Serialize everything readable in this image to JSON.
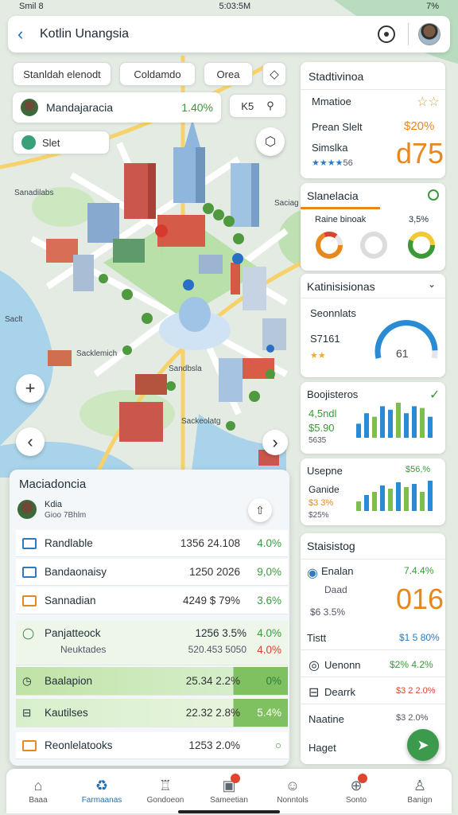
{
  "status_bar": {
    "left": "Smil 8",
    "center": "5:03:5M",
    "right": "7%"
  },
  "header": {
    "title": "Kotlin Unangsia"
  },
  "filters": {
    "chip1": "Stanldah elenodt",
    "chip2": "Coldamdo",
    "chip3": "Orea"
  },
  "user_row": {
    "name": "Mandajaracia",
    "pct": "1.40%",
    "chip": "K5"
  },
  "search_chip": {
    "label": "Slet"
  },
  "map_labels": [
    "Sanadilabs",
    "Saciag",
    "Sacklemich",
    "Sandbsla",
    "Sackeolatg",
    "Saclt"
  ],
  "stat_card": {
    "title": "Stadtivinoa",
    "row1_label": "Mmatioe",
    "row2_label": "Prean Slelt",
    "row2_value": "$20%",
    "row3_label": "Simslka",
    "big_value": "d75",
    "rating_note": "56"
  },
  "donut_card": {
    "title": "Slanelacia",
    "subtitle": "Raine binoak",
    "subtitle_value": "3,5%"
  },
  "gauge_card": {
    "title": "Katinisisionas",
    "row1": "Seonnlats",
    "row2": "S7161",
    "gauge_value": "61"
  },
  "bar_card1": {
    "title": "Boojisteros",
    "l1": "4,5ndl",
    "l2": "$5.90",
    "l3": "5635"
  },
  "bar_card2": {
    "title": "Usepne",
    "value": "$56,%",
    "l1": "Ganide",
    "l2": "$3 3%",
    "l3": "$25%"
  },
  "stats_card": {
    "title": "Staisistog",
    "row1": "Enalan",
    "row1_value": "7.4.4%",
    "row2": "Daad",
    "row3": "$6 3.5%",
    "big_value": "016",
    "row4": "Tistt",
    "row4_value": "$1 5 80%",
    "row5": "Uenonn",
    "row5_value": "$2% 4.2%",
    "row6": "Dearrk",
    "row6_value": "$3 2 2.0%",
    "row7": "Naatine",
    "row7_value": "$3 2.0%",
    "row8": "Haget"
  },
  "panel": {
    "title": "Maciadoncia",
    "user_name": "Kdia",
    "user_sub": "Gioo 7Bhlm",
    "rows": [
      {
        "label": "Randlable",
        "num": "1356 24.108",
        "val": "4.0%"
      },
      {
        "label": "Bandaonaisy",
        "num": "1250 2026",
        "val": "9,0%"
      },
      {
        "label": "Sannadian",
        "num": "4249 $ 79%",
        "val": "3.6%"
      },
      {
        "label": "Panjatteock",
        "num": "1256 3.5%",
        "val": "4.0%"
      },
      {
        "label": "Neuktades",
        "num": "520.453 5050",
        "val": "4.0%"
      },
      {
        "label": "Baalapion",
        "num": "25.34 2.2%",
        "val": "0%"
      },
      {
        "label": "Kautilses",
        "num": "22.32 2.8%",
        "val": "5.4%"
      },
      {
        "label": "Reonlelatooks",
        "num": "1253 2.0%",
        "val": ""
      }
    ]
  },
  "nav": [
    {
      "label": "Baaa",
      "glyph": "⌂"
    },
    {
      "label": "Farmaanas",
      "glyph": "♻"
    },
    {
      "label": "Gondoeon",
      "glyph": "♖"
    },
    {
      "label": "Sameetian",
      "glyph": "▣"
    },
    {
      "label": "Nonntols",
      "glyph": "☺"
    },
    {
      "label": "Sonto",
      "glyph": "⊕"
    },
    {
      "label": "Banign",
      "glyph": "♙"
    }
  ]
}
